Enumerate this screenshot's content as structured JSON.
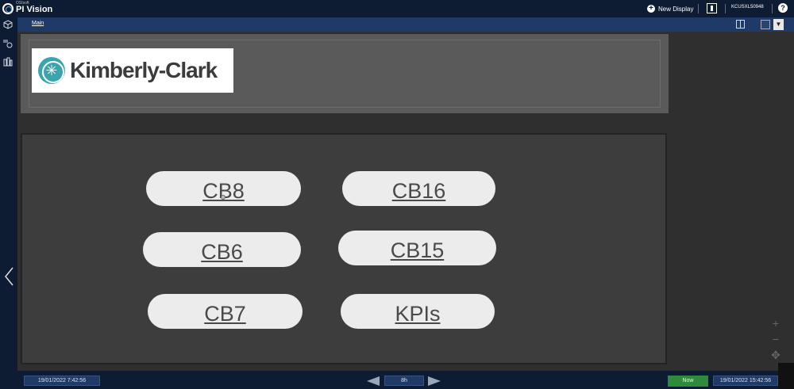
{
  "topbar": {
    "vendor": "OSIsoft",
    "app_title": "PI Vision",
    "new_display_label": "New Display",
    "user_name": "KCUSXL50948",
    "help_symbol": "?"
  },
  "tabs": {
    "main_label": "Main",
    "dropdown_symbol": "▼"
  },
  "brand": {
    "name": "Kimberly-Clark",
    "brand_color": "#3aa5ad"
  },
  "nav_buttons": [
    {
      "label": "CB8"
    },
    {
      "label": "CB16"
    },
    {
      "label": "CB6"
    },
    {
      "label": "CB15"
    },
    {
      "label": "CB7"
    },
    {
      "label": "KPIs"
    }
  ],
  "timebar": {
    "start_time": "19/01/2022 7:42:56",
    "duration": "8h",
    "now_label": "Now",
    "end_time": "19/01/2022 15:42:56"
  },
  "zoom": {
    "zoom_in_symbol": "+",
    "zoom_out_symbol": "−",
    "pan_symbol": "✥"
  },
  "icons": {
    "left_1": "cube-icon",
    "left_2": "trend-icon",
    "left_3": "library-icon"
  }
}
